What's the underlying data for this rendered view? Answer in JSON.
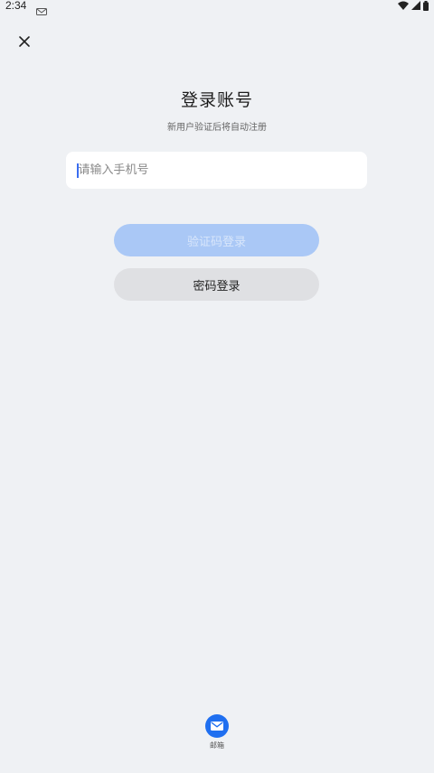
{
  "status_bar": {
    "time": "2:34"
  },
  "header": {
    "title": "登录账号",
    "subtitle": "新用户验证后将自动注册"
  },
  "phone_input": {
    "placeholder": "请输入手机号",
    "value": ""
  },
  "buttons": {
    "code_login": "验证码登录",
    "password_login": "密码登录"
  },
  "bottom": {
    "email_label": "邮箱"
  },
  "colors": {
    "background": "#eff1f4",
    "primary_disabled": "#aac8f6",
    "secondary_button": "#dfe0e3",
    "email_icon": "#1f6ff0"
  },
  "icons": [
    "close-icon",
    "wifi-icon",
    "signal-icon",
    "battery-icon",
    "notification-icon",
    "mail-icon"
  ]
}
